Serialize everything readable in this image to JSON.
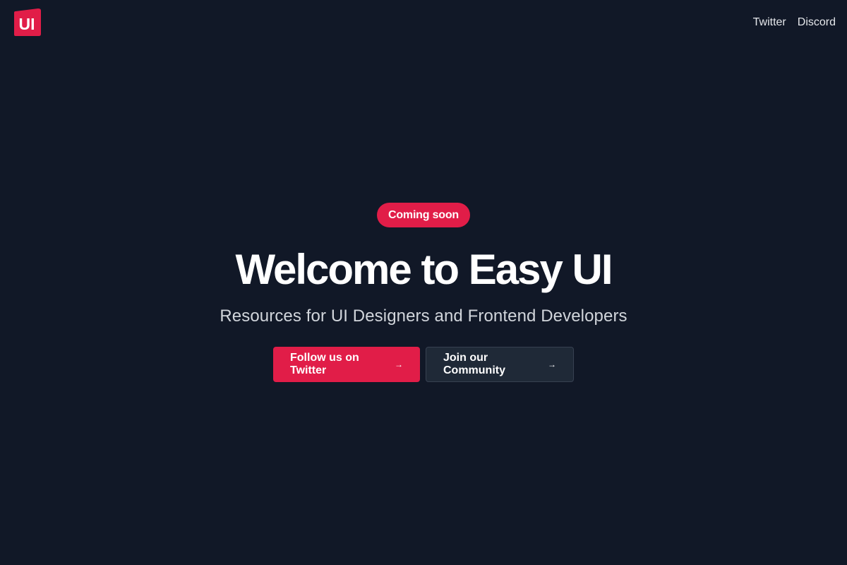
{
  "header": {
    "logo_text": "UI",
    "logo_color": "#e11d48",
    "nav": [
      {
        "label": "Twitter"
      },
      {
        "label": "Discord"
      }
    ]
  },
  "hero": {
    "badge": "Coming soon",
    "title": "Welcome to Easy UI",
    "subtitle": "Resources for UI Designers and Frontend Developers",
    "primary_button": {
      "label": "Follow us on Twitter",
      "icon": "arrow-right-icon",
      "arrow": "→"
    },
    "secondary_button": {
      "label": "Join our Community",
      "icon": "arrow-right-icon",
      "arrow": "→"
    }
  },
  "colors": {
    "background": "#111827",
    "accent": "#e11d48",
    "secondary_button": "#1f2937"
  }
}
